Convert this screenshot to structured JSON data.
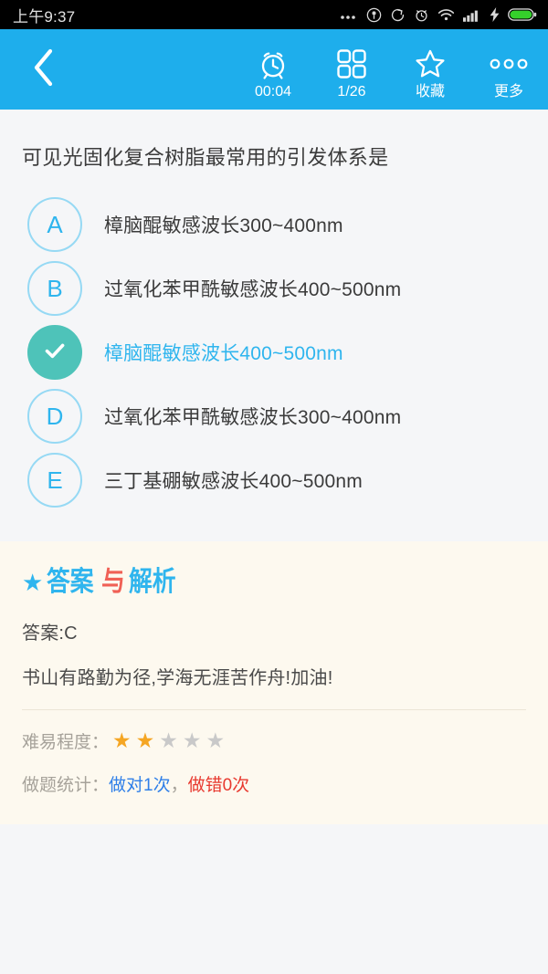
{
  "status_bar": {
    "time": "上午9:37",
    "icons": [
      "ellipsis-icon",
      "location-circle-icon",
      "sync-circle-icon",
      "alarm-clock-icon",
      "wifi-icon",
      "signal-bars-icon",
      "charging-bolt-icon",
      "battery-icon"
    ]
  },
  "header": {
    "back_icon": "chevron-left-icon",
    "actions": [
      {
        "icon": "alarm-clock-icon",
        "label": "00:04"
      },
      {
        "icon": "grid-icon",
        "label": "1/26"
      },
      {
        "icon": "star-outline-icon",
        "label": "收藏"
      },
      {
        "icon": "more-dots-icon",
        "label": "更多"
      }
    ]
  },
  "question": {
    "text": "可见光固化复合树脂最常用的引发体系是"
  },
  "options": [
    {
      "key": "A",
      "text": "樟脑醌敏感波长300~400nm",
      "selected": false
    },
    {
      "key": "B",
      "text": "过氧化苯甲酰敏感波长400~500nm",
      "selected": false
    },
    {
      "key": "C",
      "text": "樟脑醌敏感波长400~500nm",
      "selected": true
    },
    {
      "key": "D",
      "text": "过氧化苯甲酰敏感波长300~400nm",
      "selected": false
    },
    {
      "key": "E",
      "text": "三丁基硼敏感波长400~500nm",
      "selected": false
    }
  ],
  "answer_panel": {
    "title_part1": "答案",
    "title_part2": "与",
    "title_part3": "解析",
    "star_glyph": "★",
    "answer_line": "答案:C",
    "encouragement": "书山有路勤为径,学海无涯苦作舟!加油!",
    "difficulty_label": "难易程度：",
    "difficulty_filled": 2,
    "difficulty_total": 5,
    "stats_label": "做题统计：",
    "stats_correct": "做对1次",
    "stats_separator": "，",
    "stats_wrong": "做错0次"
  },
  "colors": {
    "header_blue": "#1eaeec",
    "accent_blue": "#2fb5ee",
    "selected_teal": "#4ec3b9",
    "panel_cream": "#fdf9ef",
    "page_gray": "#f5f6f8",
    "star_orange": "#f5a623",
    "stat_correct_blue": "#2f7fe8",
    "stat_wrong_red": "#e8392f",
    "title_red": "#f06055"
  }
}
